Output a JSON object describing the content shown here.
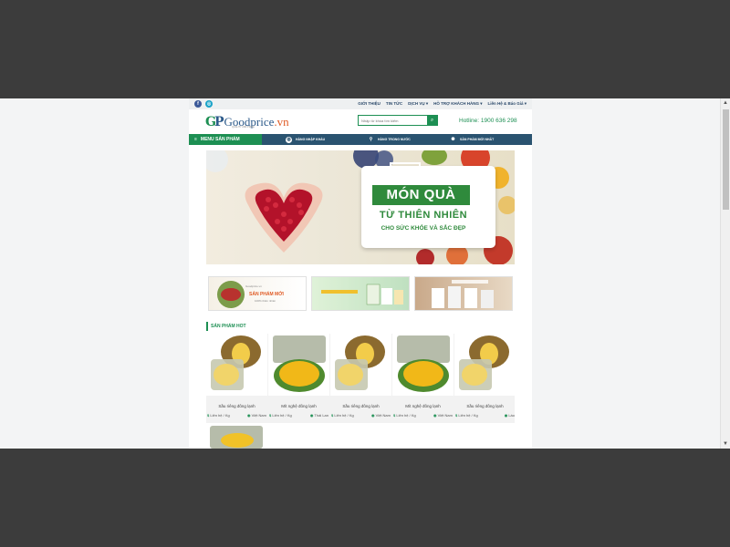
{
  "topbar": {
    "social": [
      {
        "name": "facebook-icon",
        "glyph": "f",
        "color": "#3b5998"
      },
      {
        "name": "instagram-icon",
        "glyph": "◎",
        "color": "#1aa3c8"
      }
    ],
    "nav": [
      "GIỚI THIỆU",
      "TIN TỨC",
      "DỊCH VỤ ▾",
      "HỖ TRỢ KHÁCH HÀNG ▾",
      "Liên Hệ & Báo Giá ▾"
    ]
  },
  "header": {
    "logo_mark_g": "G",
    "logo_mark_p": "P",
    "logo_name": "Goodprice",
    "logo_tld": ".vn",
    "logo_tagline": "QUALITY AND PRICE",
    "search_placeholder": "Nhập từ khóa tìm kiếm",
    "search_icon": "⌕",
    "hotline": "Hotline: 1900 636 298"
  },
  "menubar": {
    "main_label": "MENU SẢN PHẨM",
    "items": [
      "HÀNG NHẬP KHẨU",
      "HÀNG TRONG NƯỚC",
      "SẢN PHẨM MỚI NHẤT"
    ]
  },
  "banner": {
    "title": "MÓN QUÀ",
    "line2": "TỪ THIÊN NHIÊN",
    "line3": "CHO SỨC KHỎE VÀ SẮC ĐẸP"
  },
  "promos": {
    "p1_title": "Goodprice.vn",
    "p1_big": "SẢN PHẨM MỚI",
    "p1_sub": "100% thiên nhiên"
  },
  "section": {
    "title": "SẢN PHẨM HOT"
  },
  "products": [
    {
      "name": "Sầu riêng đông lạnh",
      "price": "Liên hệ / Kg",
      "origin": "Việt Nam"
    },
    {
      "name": "Mít nghệ đông lạnh",
      "price": "Liên hệ / Kg",
      "origin": "Thái Lan"
    },
    {
      "name": "Sầu riêng đông lạnh",
      "price": "Liên hệ / Kg",
      "origin": "Việt Nam"
    },
    {
      "name": "Mít nghệ đông lạnh",
      "price": "Liên hệ / Kg",
      "origin": "Việt Nam"
    },
    {
      "name": "Sầu riêng đông lạnh",
      "price": "Liên hệ / Kg",
      "origin": "Lào"
    }
  ],
  "icons": {
    "price_icon": "$",
    "origin_icon": "◉",
    "menu_icon": "≡"
  },
  "colors": {
    "brand_green": "#1d8f53",
    "nav_blue": "#2a5370",
    "logo_blue": "#2c5a8a",
    "accent_orange": "#e05a24"
  }
}
